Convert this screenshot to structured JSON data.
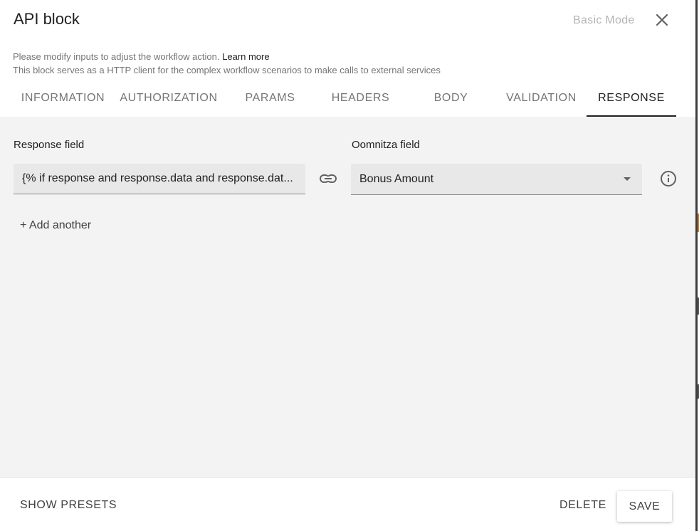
{
  "dialog": {
    "title": "API block",
    "basic_mode_label": "Basic Mode",
    "description_line1": "Please modify inputs to adjust the workflow action.",
    "learn_more": "Learn more",
    "description_line2": "This block serves as a HTTP client for the complex workflow scenarios to make calls to external services"
  },
  "tabs": [
    {
      "label": "INFORMATION",
      "active": false
    },
    {
      "label": "AUTHORIZATION",
      "active": false
    },
    {
      "label": "PARAMS",
      "active": false
    },
    {
      "label": "HEADERS",
      "active": false
    },
    {
      "label": "BODY",
      "active": false
    },
    {
      "label": "VALIDATION",
      "active": false
    },
    {
      "label": "RESPONSE",
      "active": true
    }
  ],
  "response": {
    "response_field_label": "Response field",
    "oomnitza_field_label": "Oomnitza field",
    "response_field_value": "{% if response and response.data and response.dat...",
    "oomnitza_field_value": "Bonus Amount",
    "add_another": "+ Add another"
  },
  "footer": {
    "show_presets": "SHOW PRESETS",
    "delete": "DELETE",
    "save": "SAVE"
  },
  "icons": {
    "close": "close-icon",
    "link": "link-icon",
    "info": "info-icon",
    "dropdown": "chevron-down-icon"
  },
  "colors": {
    "content_background": "#f3f3f3",
    "field_background": "#e8e8e8",
    "active_tab": "#212121",
    "muted_text": "#757575"
  }
}
